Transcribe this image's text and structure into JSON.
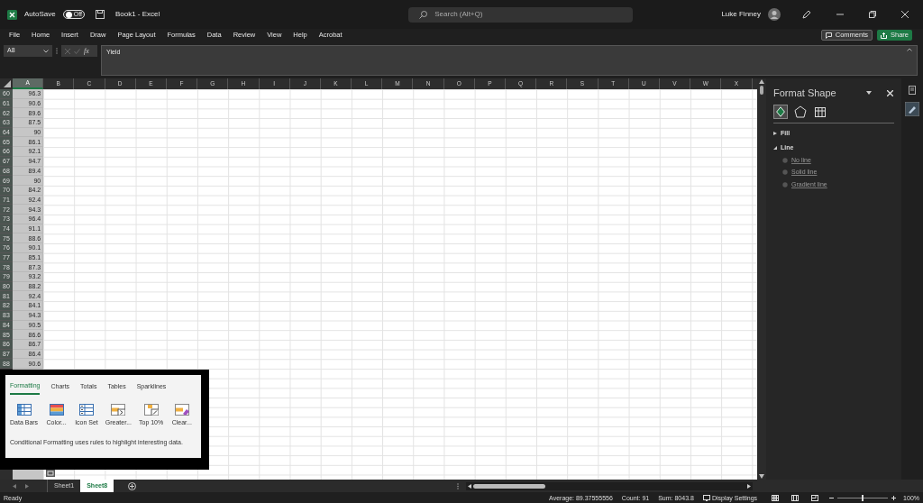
{
  "window": {
    "autosave_label": "AutoSave",
    "autosave": {
      "on": false,
      "label": "Off"
    },
    "title": "Book1 - Excel",
    "search_placeholder": "Search (Alt+Q)",
    "user": "Luke Finney"
  },
  "ribbon_tabs": [
    "File",
    "Home",
    "Insert",
    "Draw",
    "Page Layout",
    "Formulas",
    "Data",
    "Review",
    "View",
    "Help",
    "Acrobat"
  ],
  "comments_button": "Comments",
  "share_button": "Share",
  "formula_bar": {
    "name_box": "A8",
    "fx": "fx",
    "value": "Yield"
  },
  "columns": [
    {
      "label": "A",
      "selected": true
    },
    {
      "label": "B",
      "selected": false
    },
    {
      "label": "C",
      "selected": false
    },
    {
      "label": "D",
      "selected": false
    },
    {
      "label": "E",
      "selected": false
    },
    {
      "label": "F",
      "selected": false
    },
    {
      "label": "G",
      "selected": false
    },
    {
      "label": "H",
      "selected": false
    },
    {
      "label": "I",
      "selected": false
    },
    {
      "label": "J",
      "selected": false
    },
    {
      "label": "K",
      "selected": false
    },
    {
      "label": "L",
      "selected": false
    },
    {
      "label": "M",
      "selected": false
    },
    {
      "label": "N",
      "selected": false
    },
    {
      "label": "O",
      "selected": false
    },
    {
      "label": "P",
      "selected": false
    },
    {
      "label": "Q",
      "selected": false
    },
    {
      "label": "R",
      "selected": false
    },
    {
      "label": "S",
      "selected": false
    },
    {
      "label": "T",
      "selected": false
    },
    {
      "label": "U",
      "selected": false
    },
    {
      "label": "V",
      "selected": false
    },
    {
      "label": "W",
      "selected": false
    },
    {
      "label": "X",
      "selected": false
    }
  ],
  "rows": [
    {
      "row": "60",
      "value": "96.3"
    },
    {
      "row": "61",
      "value": "90.6"
    },
    {
      "row": "62",
      "value": "89.6"
    },
    {
      "row": "63",
      "value": "87.5"
    },
    {
      "row": "64",
      "value": "90"
    },
    {
      "row": "65",
      "value": "86.1"
    },
    {
      "row": "66",
      "value": "92.1"
    },
    {
      "row": "67",
      "value": "94.7"
    },
    {
      "row": "68",
      "value": "89.4"
    },
    {
      "row": "69",
      "value": "90"
    },
    {
      "row": "70",
      "value": "84.2"
    },
    {
      "row": "71",
      "value": "92.4"
    },
    {
      "row": "72",
      "value": "94.3"
    },
    {
      "row": "73",
      "value": "96.4"
    },
    {
      "row": "74",
      "value": "91.1"
    },
    {
      "row": "75",
      "value": "88.6"
    },
    {
      "row": "76",
      "value": "90.1"
    },
    {
      "row": "77",
      "value": "85.1"
    },
    {
      "row": "78",
      "value": "87.3"
    },
    {
      "row": "79",
      "value": "93.2"
    },
    {
      "row": "80",
      "value": "88.2"
    },
    {
      "row": "81",
      "value": "92.4"
    },
    {
      "row": "82",
      "value": "84.1"
    },
    {
      "row": "83",
      "value": "94.3"
    },
    {
      "row": "84",
      "value": "90.5"
    },
    {
      "row": "85",
      "value": "86.6"
    },
    {
      "row": "86",
      "value": "86.7"
    },
    {
      "row": "87",
      "value": "86.4"
    },
    {
      "row": "88",
      "value": "90.6"
    }
  ],
  "quick_analysis": {
    "tabs": [
      {
        "label": "Formatting",
        "selected": true
      },
      {
        "label": "Charts",
        "selected": false
      },
      {
        "label": "Totals",
        "selected": false
      },
      {
        "label": "Tables",
        "selected": false
      },
      {
        "label": "Sparklines",
        "selected": false
      }
    ],
    "options": [
      {
        "kind": "databars",
        "label": "Data Bars"
      },
      {
        "kind": "color",
        "label": "Color..."
      },
      {
        "kind": "iconset",
        "label": "Icon Set"
      },
      {
        "kind": "greater",
        "label": "Greater..."
      },
      {
        "kind": "top",
        "label": "Top 10%"
      },
      {
        "kind": "clear",
        "label": "Clear..."
      }
    ],
    "description": "Conditional Formatting uses rules to highlight interesting data."
  },
  "format_pane": {
    "title": "Format Shape",
    "icon_tabs": [
      {
        "kind": "fill",
        "selected": true
      },
      {
        "kind": "effects",
        "selected": false
      },
      {
        "kind": "size",
        "selected": false
      }
    ],
    "sections": [
      {
        "label": "Fill",
        "expanded": false
      },
      {
        "label": "Line",
        "expanded": true,
        "options": [
          {
            "label": "No line",
            "selected": false
          },
          {
            "label": "Solid line",
            "selected": false
          },
          {
            "label": "Gradient line",
            "selected": false
          }
        ]
      }
    ]
  },
  "sheets": [
    {
      "label": "Sheet1",
      "selected": false
    },
    {
      "label": "Sheet8",
      "selected": true
    }
  ],
  "status_bar": {
    "mode": "Ready",
    "average": "Average: 89.37555556",
    "count": "Count: 91",
    "sum": "Sum: 8043.8",
    "display_settings": "Display Settings",
    "zoom": {
      "level": 0.5
    },
    "zoom_label": "100%"
  }
}
